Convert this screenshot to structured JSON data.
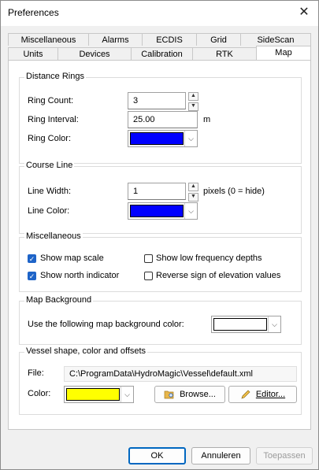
{
  "window": {
    "title": "Preferences",
    "close_icon": "close-icon"
  },
  "tabs": {
    "row1": [
      "Miscellaneous",
      "Alarms",
      "ECDIS",
      "Grid",
      "SideScan"
    ],
    "row2": [
      "Units",
      "Devices",
      "Calibration",
      "RTK",
      "Map"
    ],
    "active": "Map"
  },
  "distance_rings": {
    "title": "Distance Rings",
    "ring_count_label": "Ring Count:",
    "ring_count_value": "3",
    "ring_interval_label": "Ring Interval:",
    "ring_interval_value": "25.00",
    "ring_interval_unit": "m",
    "ring_color_label": "Ring Color:",
    "ring_color": "#0000ff"
  },
  "course_line": {
    "title": "Course Line",
    "line_width_label": "Line Width:",
    "line_width_value": "1",
    "line_width_hint": "pixels (0 = hide)",
    "line_color_label": "Line Color:",
    "line_color": "#0000ff"
  },
  "misc": {
    "title": "Miscellaneous",
    "show_map_scale": "Show map scale",
    "show_map_scale_checked": true,
    "show_north_indicator": "Show north indicator",
    "show_north_indicator_checked": true,
    "show_low_freq": "Show low frequency depths",
    "show_low_freq_checked": false,
    "reverse_sign": "Reverse sign of elevation values",
    "reverse_sign_checked": false
  },
  "map_background": {
    "title": "Map Background",
    "label": "Use the following map background color:",
    "color": "#ffffff"
  },
  "vessel": {
    "title": "Vessel shape, color and offsets",
    "file_label": "File:",
    "file_value": "C:\\ProgramData\\HydroMagic\\Vessel\\default.xml",
    "color_label": "Color:",
    "color": "#ffff00",
    "browse_label": "Browse...",
    "editor_label": "Editor..."
  },
  "footer": {
    "ok": "OK",
    "cancel": "Annuleren",
    "apply": "Toepassen"
  }
}
